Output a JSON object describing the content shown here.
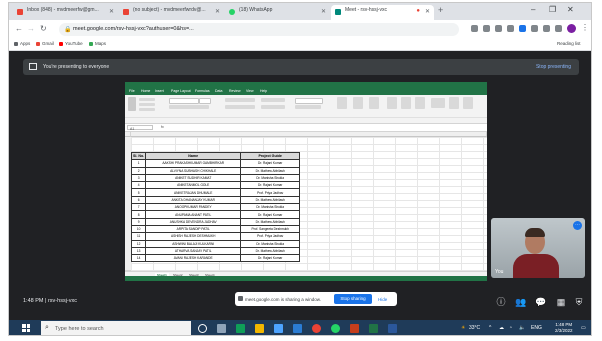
{
  "browser": {
    "tabs": [
      {
        "label": "Inbox (848) - mvdmeerfw@gm...",
        "favicon_color": "#ea4335"
      },
      {
        "label": "(no subject) - mvdmeerfwrdv@...",
        "favicon_color": "#ea4335"
      },
      {
        "label": "(18) WhatsApp",
        "favicon_color": "#25d366"
      },
      {
        "label": "Meet - rsv-hssj-vxc",
        "favicon_color": "#00897b"
      }
    ],
    "new_tab": "+",
    "url": "meet.google.com/rsv-hssj-vxc?authuser=0&hs=...",
    "bookmarks": [
      "Apps",
      "Gmail",
      "YouTube",
      "Maps"
    ],
    "reading_list": "Reading list"
  },
  "meet": {
    "banner_text": "You're presenting to everyone",
    "stop_presenting": "Stop presenting",
    "clock_meeting": "1:48 PM | rsv-hssj-vxc",
    "toast_text": "meet.google.com is sharing a window.",
    "stop_sharing": "Stop sharing",
    "hide": "Hide",
    "self_name": "You"
  },
  "excel": {
    "menu": [
      "File",
      "Home",
      "Insert",
      "Page Layout",
      "Formulas",
      "Data",
      "Review",
      "View",
      "Help"
    ],
    "name_box": "A1",
    "fx": "fx",
    "headers": [
      "Sl. No.",
      "Name",
      "Project Guide"
    ],
    "rows": [
      [
        "1",
        "AAKSHI PRAKASHKUMAR GAMBHIRKAR",
        "Dr. Rajani Kumar"
      ],
      [
        "2",
        "ALVIYNA SUBHASH CHIKHALE",
        "Dr. Mathew Abhilash"
      ],
      [
        "3",
        "ANIKET SUDHIR KAMAT",
        "Dr. Manisha Shukla"
      ],
      [
        "4",
        "ANIKETANMOL GOLE",
        "Dr. Rajani Kumar"
      ],
      [
        "5",
        "ANIKETRAJAN DHUMALE",
        "Prof. Priya Jadhav"
      ],
      [
        "6",
        "ANKITA DHANANJAY KUMAR",
        "Dr. Mathew Abhilash"
      ],
      [
        "7",
        "ANOOPKUMAR PANDEY",
        "Dr. Manisha Shukla"
      ],
      [
        "8",
        "ANUPAMA ANANT PATIL",
        "Dr. Rajani Kumar"
      ],
      [
        "9",
        "ANUSHKA DEVENDRA JADHAV",
        "Dr. Mathew Abhilash"
      ],
      [
        "10",
        "ARPITA SANDIP PATIL",
        "Prof. Sangeeta Deshmukh"
      ],
      [
        "11",
        "ASHISH RAJESH DESHMUKH",
        "Prof. Priya Jadhav"
      ],
      [
        "12",
        "ASHWINI BALAJI KULKARNI",
        "Dr. Manisha Shukla"
      ],
      [
        "13",
        "ATHARVA SANJAY PATIL",
        "Dr. Mathew Abhilash"
      ],
      [
        "14",
        "AVANI RAJESH KARANDE",
        "Dr. Rajani Kumar"
      ]
    ],
    "sheets": [
      "Sheet1",
      "Sheet2",
      "Sheet3",
      "Sheet4"
    ]
  },
  "taskbar": {
    "search_placeholder": "Type here to search",
    "weather": "33°C",
    "lang": "ENG",
    "time": "1:48 PM",
    "date": "2/3/2022"
  },
  "colors": {
    "meet_bg": "#202124",
    "excel_green": "#217346",
    "meet_blue": "#1a73e8",
    "taskbar": "#1f3b59"
  }
}
